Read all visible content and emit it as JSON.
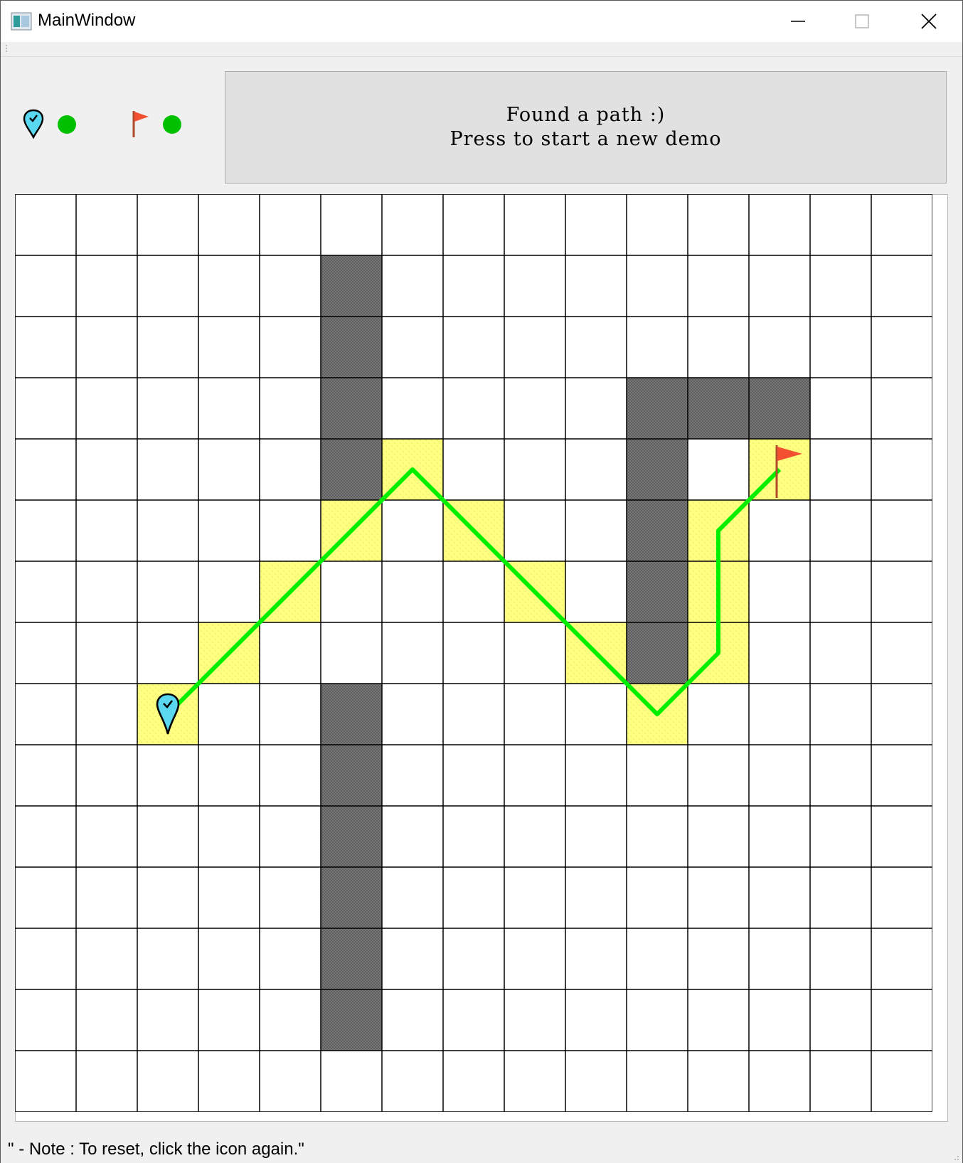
{
  "window": {
    "title": "MainWindow"
  },
  "indicators": {
    "start_icon": "map-pin-check-icon",
    "goal_icon": "red-flag-icon",
    "start_status_color": "#00c000",
    "goal_status_color": "#00c000"
  },
  "message_button": {
    "line1": "Found a path :)",
    "line2": "Press to start a new demo"
  },
  "grid": {
    "cols": 15,
    "rows": 15,
    "start": [
      2,
      8
    ],
    "goal": [
      12,
      4
    ],
    "walls": [
      [
        5,
        1
      ],
      [
        5,
        2
      ],
      [
        5,
        3
      ],
      [
        5,
        4
      ],
      [
        10,
        3
      ],
      [
        11,
        3
      ],
      [
        12,
        3
      ],
      [
        10,
        4
      ],
      [
        10,
        5
      ],
      [
        10,
        6
      ],
      [
        10,
        7
      ],
      [
        5,
        8
      ],
      [
        5,
        9
      ],
      [
        5,
        10
      ],
      [
        5,
        11
      ],
      [
        5,
        12
      ],
      [
        5,
        13
      ]
    ],
    "path_cells": [
      [
        2,
        8
      ],
      [
        3,
        7
      ],
      [
        4,
        6
      ],
      [
        5,
        5
      ],
      [
        6,
        4
      ],
      [
        7,
        5
      ],
      [
        8,
        6
      ],
      [
        9,
        7
      ],
      [
        10,
        8
      ],
      [
        11,
        7
      ],
      [
        11,
        6
      ],
      [
        11,
        5
      ],
      [
        12,
        4
      ]
    ],
    "colors": {
      "wall": "#6e6e6e",
      "path_cell": "#ffff80",
      "path_line": "#00ee00",
      "grid_line": "#000000"
    }
  },
  "status_bar": {
    "text": "\" - Note : To reset, click the icon again.\""
  }
}
